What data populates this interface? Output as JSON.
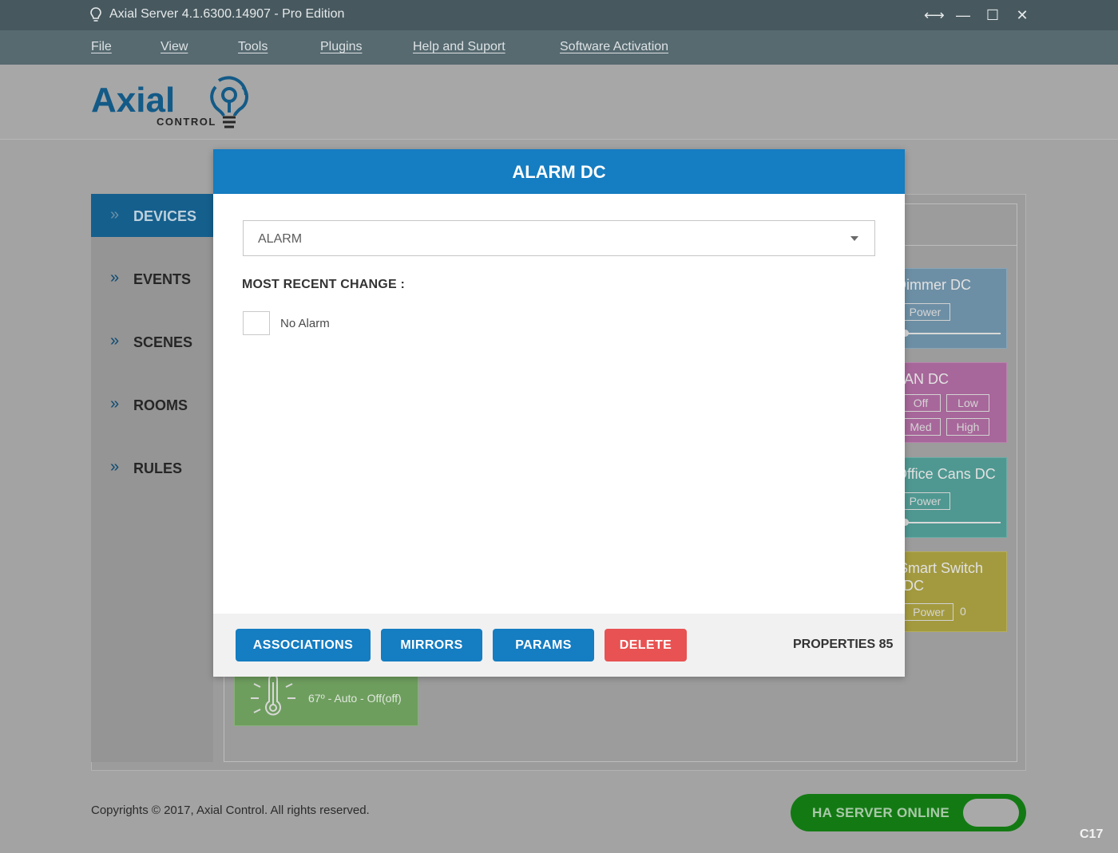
{
  "window": {
    "title": "Axial Server 4.1.6300.14907 - Pro Edition",
    "controls": {
      "resize": "⟷",
      "minimize": "—",
      "maximize": "☐",
      "close": "✕"
    }
  },
  "menu": {
    "items": [
      {
        "label": "File"
      },
      {
        "label": "View"
      },
      {
        "label": "Tools"
      },
      {
        "label": "Plugins"
      },
      {
        "label": "Help and Suport"
      },
      {
        "label": "Software Activation"
      }
    ]
  },
  "logo": {
    "text": "Axial",
    "subtext": "CONTROL"
  },
  "sidebar": {
    "items": [
      {
        "label": "DEVICES",
        "active": true
      },
      {
        "label": "EVENTS"
      },
      {
        "label": "SCENES"
      },
      {
        "label": "ROOMS"
      },
      {
        "label": "RULES"
      }
    ]
  },
  "cards": {
    "dimmer": {
      "name": "Dimmer DC",
      "power": "Power"
    },
    "fan": {
      "name": "FAN DC",
      "off": "Off",
      "low": "Low",
      "med": "Med",
      "high": "High"
    },
    "office": {
      "name": "Office Cans DC",
      "power": "Power"
    },
    "smartswitch": {
      "name_line1": "Smart Switch",
      "name_line2": "DC",
      "power": "Power",
      "value": "0"
    },
    "thermostat": {
      "status": "67º - Auto - Off(off)"
    }
  },
  "modal": {
    "title": "ALARM DC",
    "select_value": "ALARM",
    "most_recent_label": "MOST RECENT CHANGE :",
    "checkbox_label": "No Alarm",
    "buttons": {
      "associations": "ASSOCIATIONS",
      "mirrors": "MIRRORS",
      "params": "PARAMS",
      "delete": "DELETE"
    },
    "properties": "PROPERTIES 85"
  },
  "footer": {
    "copyright": "Copyrights © 2017, Axial Control. All rights reserved.",
    "server_status": "HA SERVER ONLINE",
    "corner_label": "C17"
  },
  "colors": {
    "accent": "#157dc1",
    "delete": "#e85252",
    "online": "#137a13",
    "titlebar": "#47595f"
  }
}
